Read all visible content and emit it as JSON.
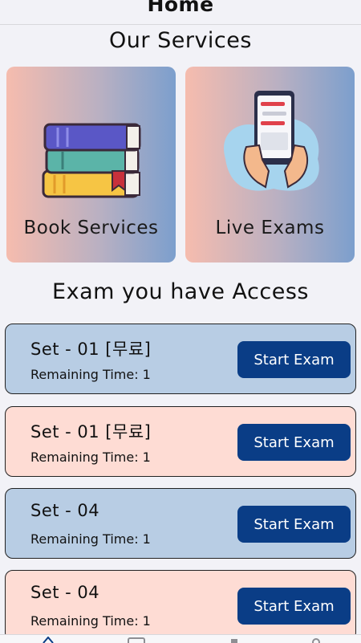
{
  "header": {
    "title": "Home"
  },
  "services": {
    "title": "Our Services",
    "items": [
      {
        "label": "Book Services",
        "icon": "books-icon"
      },
      {
        "label": "Live Exams",
        "icon": "phone-exam-icon"
      }
    ]
  },
  "exams": {
    "title": "Exam you have Access",
    "items": [
      {
        "name": "Set - 01 [무료]",
        "remaining": "Remaining Time: 1",
        "button": "Start Exam",
        "color": "#b8cde4"
      },
      {
        "name": "Set - 01 [무료]",
        "remaining": "Remaining Time: 1",
        "button": "Start Exam",
        "color": "#fedcd4"
      },
      {
        "name": "Set - 04",
        "remaining": "Remaining Time: 1",
        "button": "Start Exam",
        "color": "#b8cde4"
      },
      {
        "name": "Set - 04",
        "remaining": "Remaining Time: 1",
        "button": "Start Exam",
        "color": "#fedcd4"
      }
    ]
  },
  "colors": {
    "accent": "#0a3d86",
    "background": "#f2f2f7"
  },
  "tabbar": {
    "icons": [
      "home-tab-icon",
      "list-tab-icon",
      "book-tab-icon",
      "profile-tab-icon"
    ]
  }
}
